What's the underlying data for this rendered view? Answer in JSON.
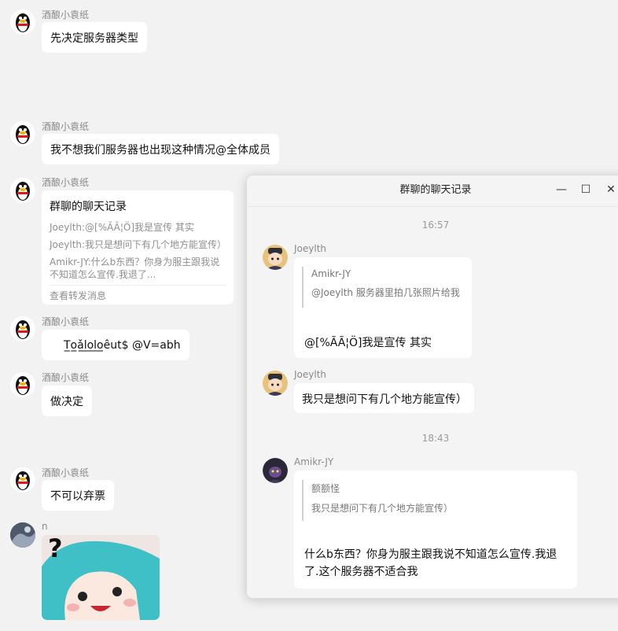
{
  "messages": {
    "m1": {
      "sender": "酒酿小袁纸",
      "text": "先决定服务器类型"
    },
    "m2": {
      "sender": "酒酿小袁纸",
      "text": "我不想我们服务器也出现这种情况@全体成员"
    },
    "m3": {
      "sender": "酒酿小袁纸",
      "card": {
        "title": "群聊的聊天记录",
        "lines": [
          "Joeylth:@[%ÃÃ¦Ö]我是宣传 其实",
          "Joeylth:我只是想问下有几个地方能宣传）",
          "Amikr-JY:什么b东西？你身为服主跟我说",
          "不知道怎么宣传.我退了..."
        ],
        "link": "查看转发消息"
      }
    },
    "m4": {
      "sender": "酒酿小袁纸",
      "text": "T̲o̲ǎ̲l̲o̲l̲o̲êut$ @V=abh"
    },
    "m5": {
      "sender": "酒酿小袁纸",
      "text": "做决定"
    },
    "m6": {
      "sender": "酒酿小袁纸",
      "text": "不可以弃票"
    },
    "m7": {
      "sender": "n",
      "text": "?"
    }
  },
  "window": {
    "title": "群聊的聊天记录",
    "buttons": {
      "minimize": "—",
      "maximize": "☐",
      "close": "✕"
    },
    "time1": "16:57",
    "time2": "18:43",
    "msg1": {
      "sender": "Joeylth",
      "quote_name": "Amikr-JY",
      "quote_text": "@Joeylth 服务器里拍几张照片给我",
      "text": "@[%ÃÃ¦Ö]我是宣传 其实"
    },
    "msg2": {
      "sender": "Joeylth",
      "text": "我只是想问下有几个地方能宣传）"
    },
    "msg3": {
      "sender": "Amikr-JY",
      "quote_name": "额额怪",
      "quote_text": "我只是想问下有几个地方能宣传）",
      "text_line1": "什么b东西？你身为服主跟我说不知道怎么宣传.我退",
      "text_line2": "了.这个服务器不适合我"
    }
  },
  "colors": {
    "background": "#f2f2f2",
    "bubble": "#ffffff",
    "muted": "#8a8a8a"
  }
}
